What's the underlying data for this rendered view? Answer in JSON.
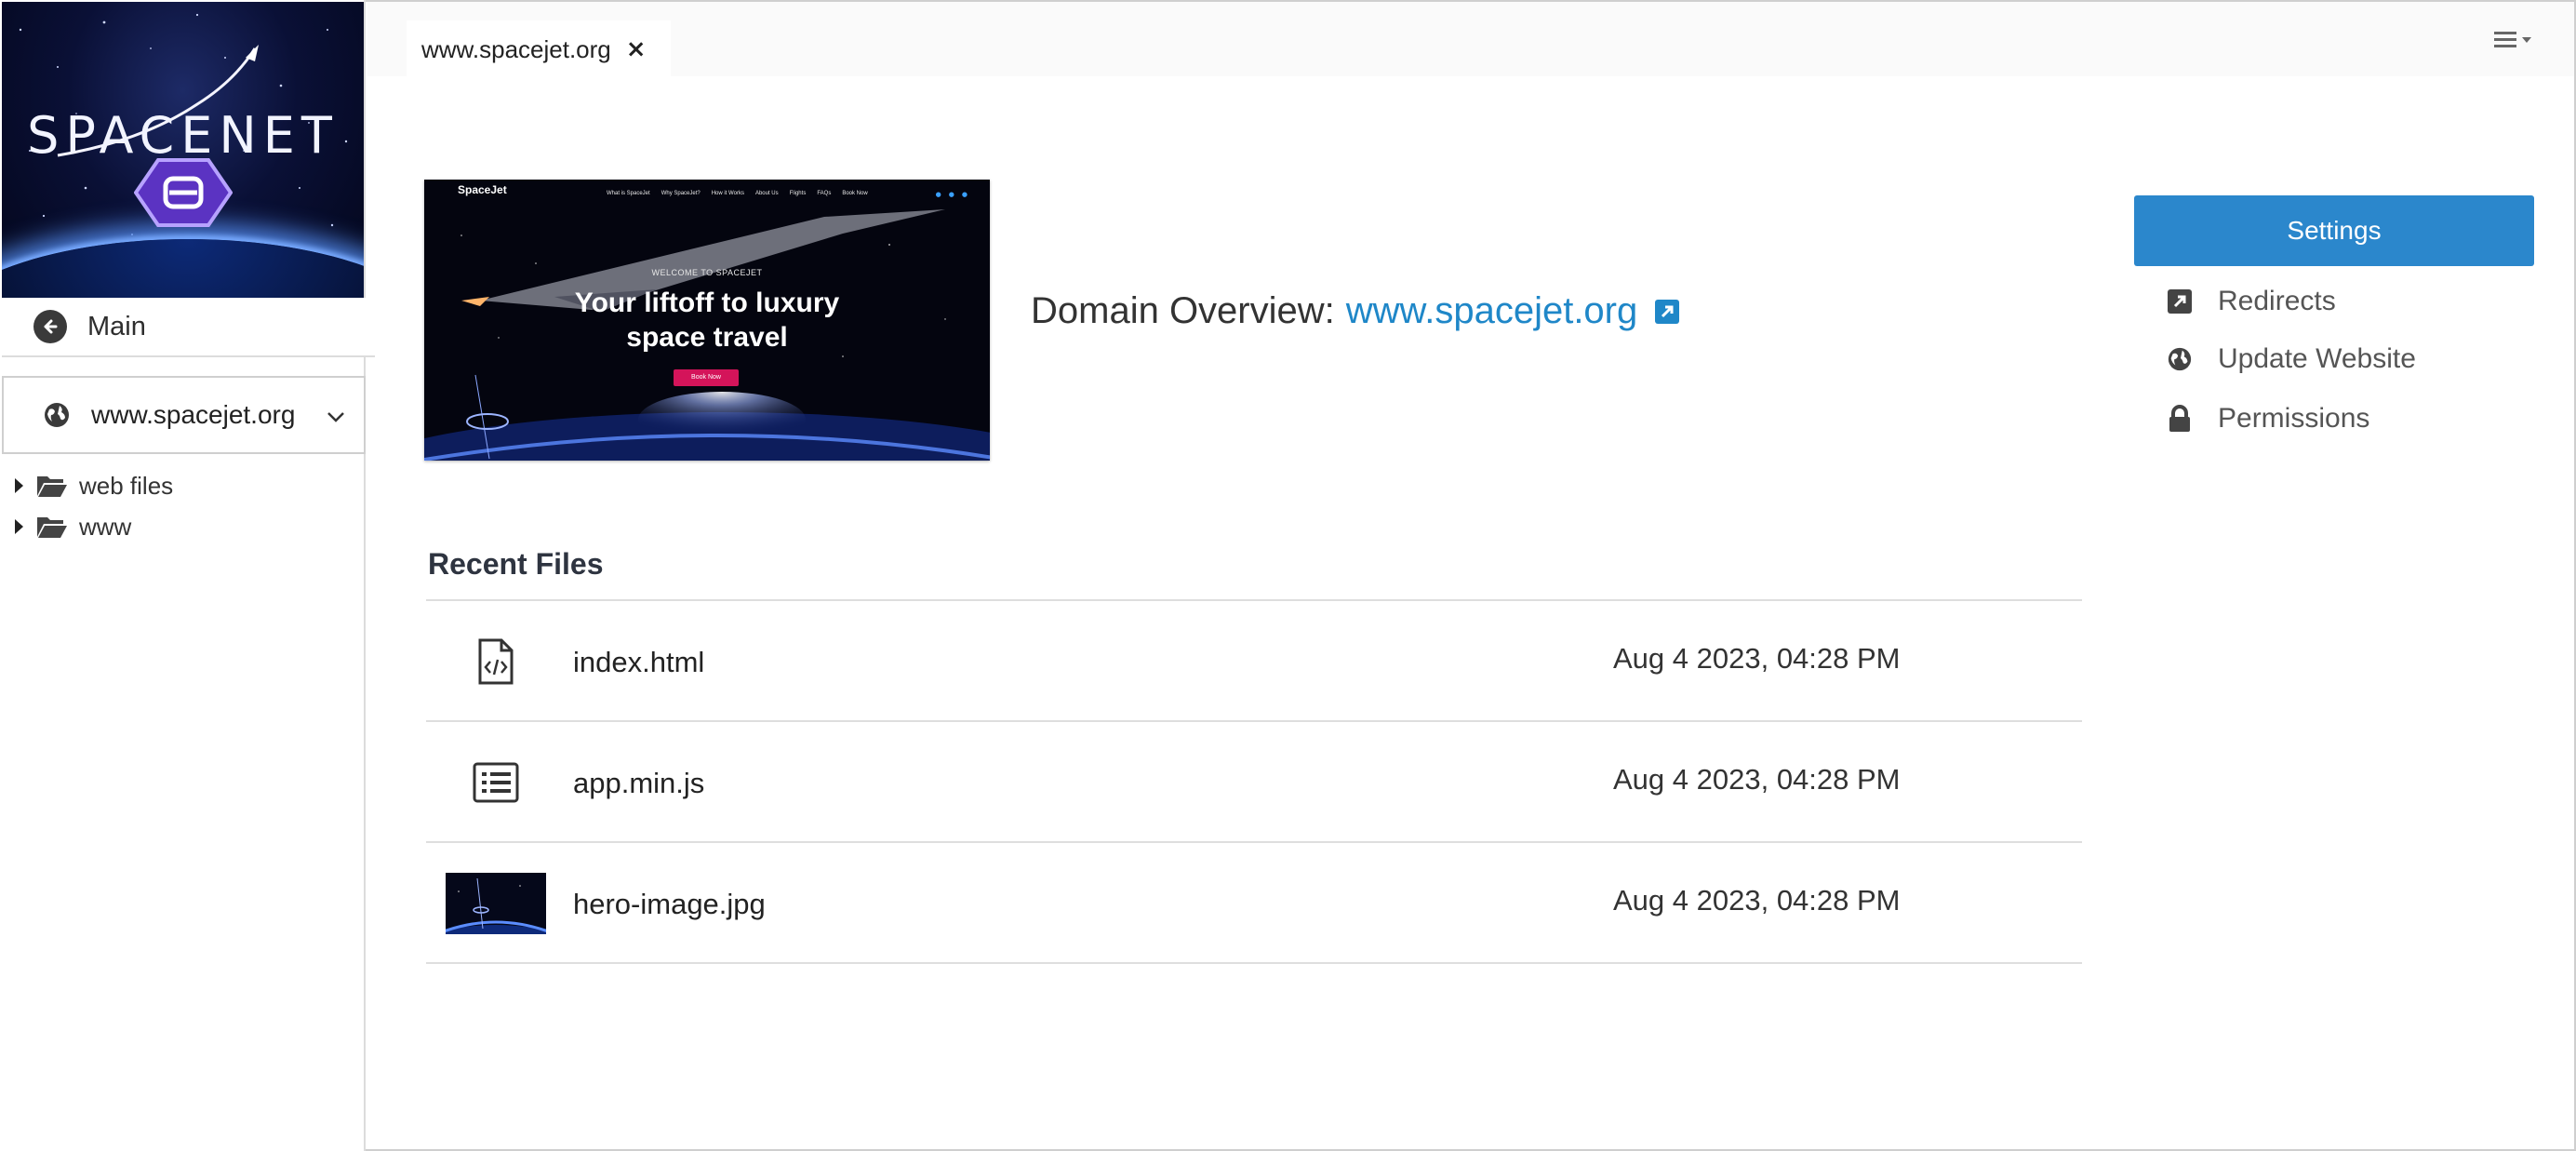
{
  "sidebar": {
    "logo_text": "SPACENET",
    "main_label": "Main",
    "domain_selector": "www.spacejet.org",
    "tree": [
      {
        "label": "web files"
      },
      {
        "label": "www"
      }
    ]
  },
  "tabbar": {
    "tabs": [
      {
        "label": "www.spacejet.org",
        "close": "×"
      }
    ]
  },
  "preview": {
    "brand": "SpaceJet",
    "nav_links": [
      "What is SpaceJet",
      "Why SpaceJet?",
      "How it Works",
      "About Us",
      "Flights",
      "FAQs",
      "Book Now"
    ],
    "welcome": "WELCOME TO SPACEJET",
    "hero_line1": "Your liftoff to luxury",
    "hero_line2": "space travel",
    "cta": "Book Now"
  },
  "overview": {
    "prefix": "Domain Overview:",
    "domain": "www.spacejet.org"
  },
  "actions": {
    "settings": "Settings",
    "items": [
      {
        "label": "Redirects",
        "icon": "external-link-icon"
      },
      {
        "label": "Update Website",
        "icon": "globe-icon"
      },
      {
        "label": "Permissions",
        "icon": "lock-icon"
      }
    ]
  },
  "recent": {
    "title": "Recent Files",
    "files": [
      {
        "name": "index.html",
        "date": "Aug 4 2023, 04:28 PM",
        "icon": "code-file-icon"
      },
      {
        "name": "app.min.js",
        "date": "Aug 4 2023, 04:28 PM",
        "icon": "list-file-icon"
      },
      {
        "name": "hero-image.jpg",
        "date": "Aug 4 2023, 04:28 PM",
        "icon": "image-thumbnail"
      }
    ]
  },
  "colors": {
    "accent": "#2b87cc",
    "link": "#1f87c8",
    "logo_purple": "#6a3fd0"
  }
}
